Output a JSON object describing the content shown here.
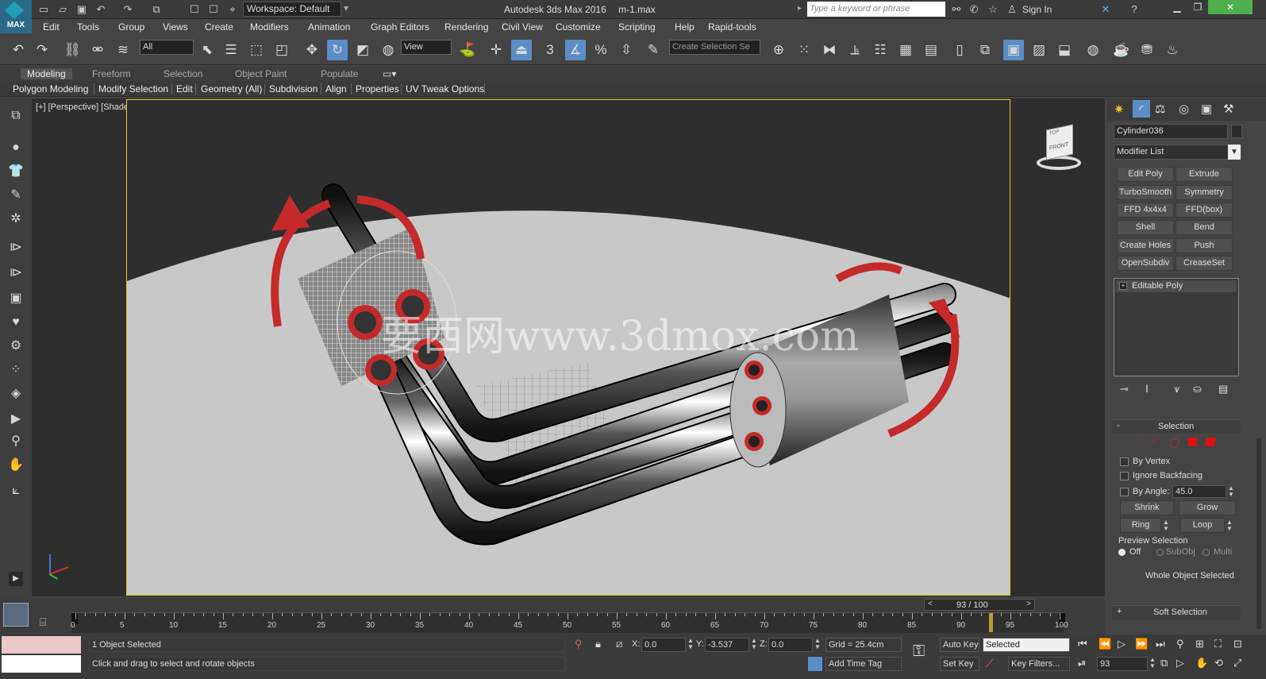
{
  "app": {
    "title": "Autodesk 3ds Max 2016",
    "file": "m-1.max",
    "logo": "MAX",
    "workspace": "Workspace: Default",
    "search_placeholder": "Type a keyword or phrase",
    "sign_in": "Sign In"
  },
  "menu": [
    "Edit",
    "Tools",
    "Group",
    "Views",
    "Create",
    "Modifiers",
    "Animation",
    "Graph Editors",
    "Rendering",
    "Civil View",
    "Customize",
    "Scripting",
    "Help",
    "Rapid-tools"
  ],
  "toolbar": {
    "filter_value": "All",
    "ref_coord": "View",
    "selection_set_placeholder": "Create Selection Se",
    "snap_label": "3",
    "percent_snap": "%"
  },
  "ribbon": {
    "tabs": [
      "Modeling",
      "Freeform",
      "Selection",
      "Object Paint",
      "Populate"
    ],
    "active_tab": "Modeling",
    "subtabs": [
      "Polygon Modeling",
      "Modify Selection",
      "Edit",
      "Geometry (All)",
      "Subdivision",
      "Align",
      "Properties",
      "UV Tweak Options"
    ]
  },
  "viewport": {
    "label": "[+] [Perspective] [Shaded]",
    "watermark": "要西网www.3dmox.com",
    "viewcube_label": "FRONT",
    "viewcube_top": "TOP"
  },
  "command_panel": {
    "object_name": "Cylinder036",
    "modifier_list": "Modifier List",
    "modifier_buttons": [
      "Edit Poly",
      "Extrude",
      "TurboSmooth",
      "Symmetry",
      "FFD 4x4x4",
      "FFD(box)",
      "Shell",
      "Bend",
      "Create Holes",
      "Push",
      "OpenSubdiv",
      "CreaseSet"
    ],
    "stack_item": "Editable Poly",
    "selection_rollout": "Selection",
    "by_vertex": "By Vertex",
    "ignore_backfacing": "Ignore Backfacing",
    "by_angle": "By Angle:",
    "by_angle_value": "45.0",
    "shrink": "Shrink",
    "grow": "Grow",
    "ring": "Ring",
    "loop": "Loop",
    "preview_selection": "Preview Selection",
    "preview_off": "Off",
    "preview_subobj": "SubObj",
    "preview_multi": "Multi",
    "whole_object": "Whole Object Selected",
    "soft_selection": "Soft Selection",
    "collapse_minus": "-",
    "collapse_plus": "+"
  },
  "timeline": {
    "frame_display": "93 / 100",
    "current_frame": 93,
    "total_frames": 100,
    "ticks": [
      "0",
      "5",
      "10",
      "15",
      "20",
      "25",
      "30",
      "35",
      "40",
      "45",
      "50",
      "55",
      "60",
      "65",
      "70",
      "75",
      "80",
      "85",
      "90",
      "95",
      "100"
    ]
  },
  "status": {
    "selected": "1 Object Selected",
    "prompt": "Click and drag to select and rotate objects",
    "x_label": "X:",
    "x_value": "0.0",
    "y_label": "Y:",
    "y_value": "-3.537",
    "z_label": "Z:",
    "z_value": "0.0",
    "grid": "Grid = 25.4cm",
    "add_time_tag": "Add Time Tag",
    "auto_key": "Auto Key",
    "set_key": "Set Key",
    "key_mode": "Selected",
    "key_filters": "Key Filters...",
    "frame_field": "93"
  },
  "colors": {
    "accent": "#5b8ec7",
    "viewport_border": "#d8d030",
    "gizmo_red": "#c42a2a",
    "ground": "#c8c8c8"
  }
}
